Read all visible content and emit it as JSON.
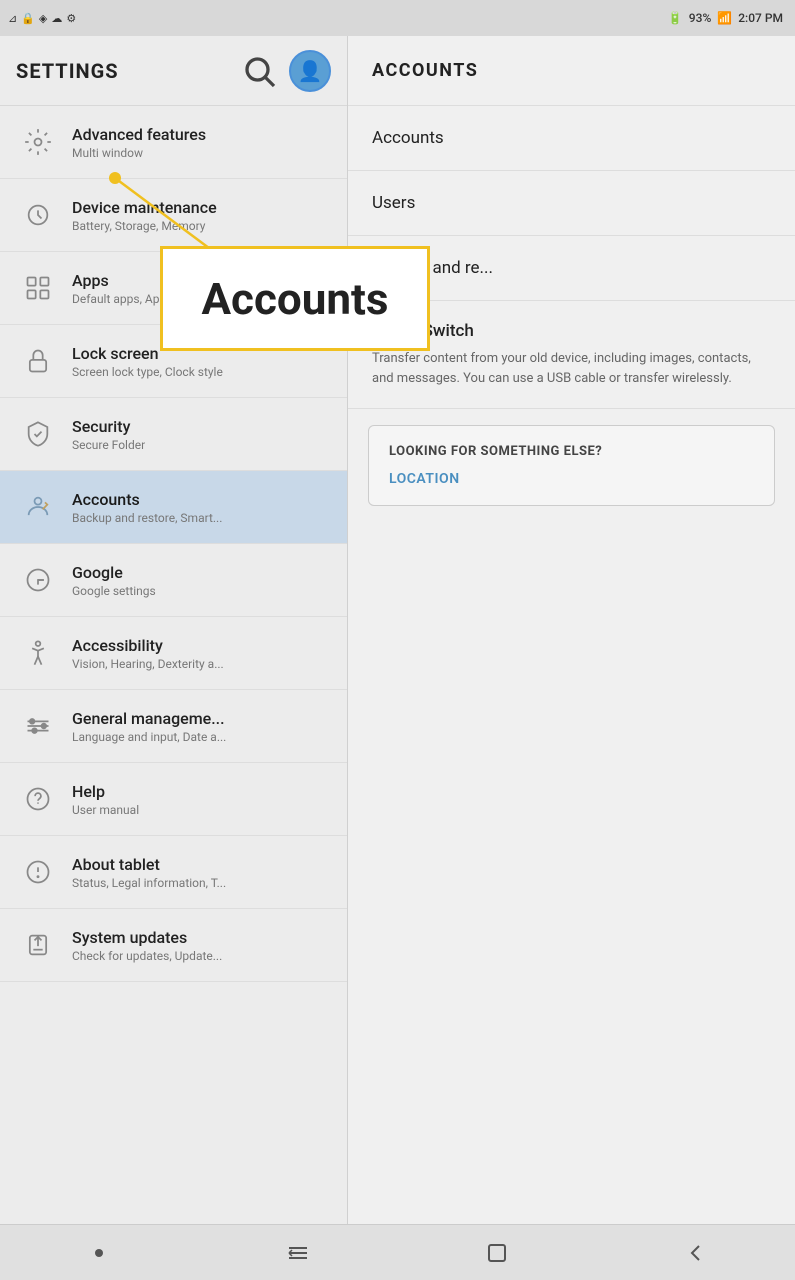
{
  "statusBar": {
    "icons_left": [
      "signal",
      "lock",
      "dropbox",
      "cloud",
      "settings2"
    ],
    "battery": "93%",
    "time": "2:07 PM",
    "battery_icon": "🔋"
  },
  "header": {
    "title": "SETTINGS",
    "search_label": "search",
    "profile_label": "profile"
  },
  "sidebar": {
    "items": [
      {
        "id": "advanced",
        "title": "Advanced features",
        "subtitle": "Multi window",
        "active": false
      },
      {
        "id": "device",
        "title": "Device maintenance",
        "subtitle": "Battery, Storage, Memory",
        "active": false
      },
      {
        "id": "apps",
        "title": "Apps",
        "subtitle": "Default apps, App permissi...",
        "active": false
      },
      {
        "id": "lockscreen",
        "title": "Lock screen",
        "subtitle": "Screen lock type, Clock style",
        "active": false
      },
      {
        "id": "security",
        "title": "Security",
        "subtitle": "Secure Folder",
        "active": false
      },
      {
        "id": "accounts",
        "title": "Accounts",
        "subtitle": "Backup and restore, Smart...",
        "active": true
      },
      {
        "id": "google",
        "title": "Google",
        "subtitle": "Google settings",
        "active": false
      },
      {
        "id": "accessibility",
        "title": "Accessibility",
        "subtitle": "Vision, Hearing, Dexterity a...",
        "active": false
      },
      {
        "id": "general",
        "title": "General manageme...",
        "subtitle": "Language and input, Date a...",
        "active": false
      },
      {
        "id": "help",
        "title": "Help",
        "subtitle": "User manual",
        "active": false
      },
      {
        "id": "about",
        "title": "About tablet",
        "subtitle": "Status, Legal information, T...",
        "active": false
      },
      {
        "id": "updates",
        "title": "System updates",
        "subtitle": "Check for updates, Update...",
        "active": false
      }
    ]
  },
  "rightPane": {
    "header": "ACCOUNTS",
    "menuItems": [
      {
        "id": "accounts-menu",
        "label": "Accounts"
      },
      {
        "id": "users-menu",
        "label": "Users"
      },
      {
        "id": "backup-menu",
        "label": "Backup and re..."
      }
    ],
    "smartSwitch": {
      "title": "Smart Switch",
      "description": "Transfer content from your old device, including images, contacts, and messages. You can use a USB cable or transfer wirelessly."
    },
    "lookingBox": {
      "title": "LOOKING FOR SOMETHING ELSE?",
      "link": "LOCATION"
    }
  },
  "annotation": {
    "highlightText": "Accounts"
  },
  "bottomNav": {
    "menu_label": "menu",
    "home_label": "home",
    "back_label": "back"
  }
}
